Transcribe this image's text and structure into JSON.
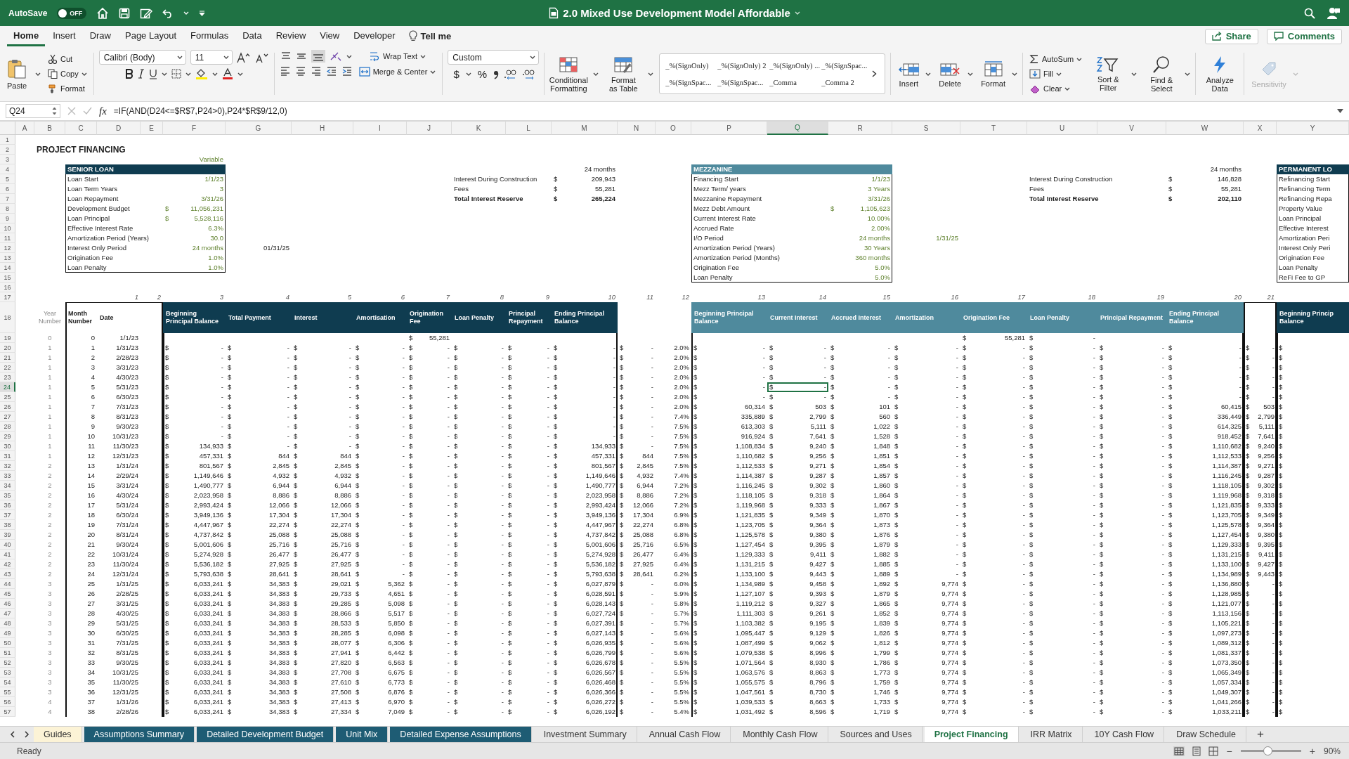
{
  "title_bar": {
    "autosave_label": "AutoSave",
    "autosave_on": false,
    "autosave_state": "OFF",
    "title": "2.0 Mixed Use Development Model Affordable"
  },
  "menu_tabs": [
    {
      "label": "Home",
      "selected": true
    },
    {
      "label": "Insert",
      "selected": false
    },
    {
      "label": "Draw",
      "selected": false
    },
    {
      "label": "Page Layout",
      "selected": false
    },
    {
      "label": "Formulas",
      "selected": false
    },
    {
      "label": "Data",
      "selected": false
    },
    {
      "label": "Review",
      "selected": false
    },
    {
      "label": "View",
      "selected": false
    },
    {
      "label": "Developer",
      "selected": false
    }
  ],
  "tell_me": "Tell me",
  "share": "Share",
  "comments": "Comments",
  "ribbon": {
    "paste": "Paste",
    "cut": "Cut",
    "copy": "Copy",
    "format_painter": "Format",
    "font_name": "Calibri (Body)",
    "font_size": "11",
    "wrap_text": "Wrap Text",
    "merge": "Merge & Center",
    "number_format": "Custom",
    "currency": "$",
    "percent": "%",
    "conditional": "Conditional Formatting",
    "format_table": "Format as Table",
    "styles": [
      "_%(SignOnly)",
      "_%(SignOnly) 2",
      "_%(SignOnly) ...",
      "_%(SignSpac...",
      "_%(SignSpac...",
      "_%(SignSpac...",
      "_Comma",
      "_Comma 2"
    ],
    "cells": [
      "Insert",
      "Delete",
      "Format"
    ],
    "autosum": "AutoSum",
    "fill": "Fill",
    "clear": "Clear",
    "sort": "Sort & Filter",
    "find": "Find & Select",
    "analyze": "Analyze Data",
    "sensitivity": {
      "label": "Sensitivity",
      "disabled": true
    }
  },
  "formula_bar": {
    "name_box": "Q24",
    "fx": "fx",
    "formula": "=IF(AND(D24<=$R$7,P24>0),P24*$R$9/12,0)"
  },
  "columns": [
    {
      "letter": "A",
      "selected": false
    },
    {
      "letter": "B",
      "kind": "muted",
      "selected": false
    },
    {
      "letter": "C",
      "kind": "number",
      "selected": false
    },
    {
      "letter": "D",
      "kind": "number",
      "selected": false
    },
    {
      "letter": "E",
      "selected": false
    },
    {
      "letter": "F",
      "kind": "accounting",
      "selected": false
    },
    {
      "letter": "G",
      "kind": "accounting",
      "selected": false
    },
    {
      "letter": "H",
      "kind": "accounting",
      "selected": false
    },
    {
      "letter": "I",
      "kind": "accounting",
      "selected": false
    },
    {
      "letter": "J",
      "kind": "accounting",
      "selected": false
    },
    {
      "letter": "K",
      "kind": "accounting",
      "selected": false
    },
    {
      "letter": "L",
      "kind": "accounting",
      "selected": false
    },
    {
      "letter": "M",
      "kind": "accounting",
      "selected": false
    },
    {
      "letter": "N",
      "kind": "accounting",
      "selected": false
    },
    {
      "letter": "O",
      "kind": "number",
      "selected": false
    },
    {
      "letter": "P",
      "kind": "accounting",
      "selected": false
    },
    {
      "letter": "Q",
      "kind": "accounting",
      "selected": true
    },
    {
      "letter": "R",
      "kind": "accounting",
      "selected": false
    },
    {
      "letter": "S",
      "kind": "accounting",
      "selected": false
    },
    {
      "letter": "T",
      "kind": "accounting",
      "selected": false
    },
    {
      "letter": "U",
      "kind": "accounting",
      "selected": false
    },
    {
      "letter": "V",
      "kind": "accounting",
      "selected": false
    },
    {
      "letter": "W",
      "kind": "accounting",
      "selected": false
    },
    {
      "letter": "X",
      "kind": "accounting",
      "selected": false
    },
    {
      "letter": "Y",
      "kind": "text",
      "selected": false
    }
  ],
  "row_headers": [
    {
      "label": "1",
      "selected": false
    },
    {
      "label": "2",
      "selected": false
    },
    {
      "label": "3",
      "selected": false
    },
    {
      "label": "4",
      "selected": false
    },
    {
      "label": "5",
      "selected": false
    },
    {
      "label": "6",
      "selected": false
    },
    {
      "label": "7",
      "selected": false
    },
    {
      "label": "8",
      "selected": false
    },
    {
      "label": "9",
      "selected": false
    },
    {
      "label": "10",
      "selected": false
    },
    {
      "label": "11",
      "selected": false
    },
    {
      "label": "12",
      "selected": false
    },
    {
      "label": "13",
      "selected": false
    },
    {
      "label": "14",
      "selected": false
    },
    {
      "label": "15",
      "selected": false
    },
    {
      "label": "16",
      "selected": false
    },
    {
      "label": "17",
      "selected": false
    },
    {
      "label": "18",
      "selected": false
    },
    {
      "label": "19",
      "selected": false
    },
    {
      "label": "20",
      "selected": false
    },
    {
      "label": "21",
      "selected": false
    },
    {
      "label": "22",
      "selected": false
    },
    {
      "label": "23",
      "selected": false
    },
    {
      "label": "24",
      "selected": true
    },
    {
      "label": "25",
      "selected": false
    },
    {
      "label": "26",
      "selected": false
    },
    {
      "label": "27",
      "selected": false
    },
    {
      "label": "28",
      "selected": false
    },
    {
      "label": "29",
      "selected": false
    },
    {
      "label": "30",
      "selected": false
    },
    {
      "label": "31",
      "selected": false
    },
    {
      "label": "32",
      "selected": false
    },
    {
      "label": "33",
      "selected": false
    },
    {
      "label": "34",
      "selected": false
    },
    {
      "label": "35",
      "selected": false
    },
    {
      "label": "36",
      "selected": false
    },
    {
      "label": "37",
      "selected": false
    },
    {
      "label": "38",
      "selected": false
    },
    {
      "label": "39",
      "selected": false
    },
    {
      "label": "40",
      "selected": false
    },
    {
      "label": "41",
      "selected": false
    },
    {
      "label": "42",
      "selected": false
    },
    {
      "label": "43",
      "selected": false
    },
    {
      "label": "44",
      "selected": false
    },
    {
      "label": "45",
      "selected": false
    },
    {
      "label": "46",
      "selected": false
    },
    {
      "label": "47",
      "selected": false
    },
    {
      "label": "48",
      "selected": false
    },
    {
      "label": "49",
      "selected": false
    },
    {
      "label": "50",
      "selected": false
    },
    {
      "label": "51",
      "selected": false
    },
    {
      "label": "52",
      "selected": false
    },
    {
      "label": "53",
      "selected": false
    },
    {
      "label": "54",
      "selected": false
    },
    {
      "label": "55",
      "selected": false
    },
    {
      "label": "56",
      "selected": false
    },
    {
      "label": "57",
      "selected": false
    }
  ],
  "sheet_title": "PROJECT FINANCING",
  "senior_loan": {
    "note": "Variable",
    "title": "SENIOR LOAN",
    "io_end": "01/31/25",
    "fields": [
      {
        "label": "Loan Start",
        "value": "1/1/23"
      },
      {
        "label": "Loan Term Years",
        "value": "3"
      },
      {
        "label": "Loan Repayment",
        "value": "3/31/26"
      },
      {
        "label": "Development Budget",
        "currency": "$",
        "value": "11,056,231"
      },
      {
        "label": "Loan Principal",
        "currency": "$",
        "value": "5,528,116"
      },
      {
        "label": "Effective Interest Rate",
        "value": "6.3%"
      },
      {
        "label": "Amortization Period (Years)",
        "value": "30.0"
      },
      {
        "label": "Interest Only Period",
        "value": "24 months"
      },
      {
        "label": "Origination Fee",
        "value": "1.0%"
      },
      {
        "label": "Loan Penalty",
        "value": "1.0%"
      }
    ]
  },
  "senior_reserve": {
    "term": "24 months",
    "items": [
      {
        "label": "Interest During Construction",
        "currency": "$",
        "value": "209,943",
        "bold": false
      },
      {
        "label": "Fees",
        "currency": "$",
        "value": "55,281",
        "bold": false
      },
      {
        "label": "Total Interest Reserve",
        "currency": "$",
        "value": "265,224",
        "bold": true
      }
    ]
  },
  "mezzanine": {
    "title": "MEZZANINE",
    "io_end": "1/31/25",
    "fields": [
      {
        "label": "Financing Start",
        "value": "1/1/23"
      },
      {
        "label": "Mezz Term/ years",
        "value": "3 Years"
      },
      {
        "label": "Mezzanine Repayment",
        "value": "3/31/26"
      },
      {
        "label": "Mezz Debt Amount",
        "currency": "$",
        "value": "1,105,623"
      },
      {
        "label": "Current Interest Rate",
        "value": "10.00%"
      },
      {
        "label": "Accrued Rate",
        "value": "2.00%"
      },
      {
        "label": "I/O Period",
        "value": "24 months"
      },
      {
        "label": "Amortization Period (Years)",
        "value": "30 Years"
      },
      {
        "label": "Amortization Period (Months)",
        "value": "360 months"
      },
      {
        "label": "Origination Fee",
        "value": "5.0%"
      },
      {
        "label": "Loan Penalty",
        "value": "5.0%"
      }
    ]
  },
  "mezz_reserve": {
    "term": "24 months",
    "items": [
      {
        "label": "Interest During Construction",
        "currency": "$",
        "value": "146,828",
        "bold": false
      },
      {
        "label": "Fees",
        "currency": "$",
        "value": "55,281",
        "bold": false
      },
      {
        "label": "Total Interest Reserve",
        "currency": "$",
        "value": "202,110",
        "bold": true
      }
    ]
  },
  "permanent_loan": {
    "title": "PERMANENT LO",
    "fields": [
      "Refinancing Start",
      "Refinancing Term",
      "Refinancing Repa",
      "Property Value",
      "Loan Principal",
      "Effective Interest",
      "Amortization Peri",
      "Interest Only Peri",
      "Origination Fee",
      "Loan Penalty",
      "ReFi Fee to GP"
    ]
  },
  "column_numbers": [
    "1",
    "2",
    "3",
    "4",
    "5",
    "6",
    "7",
    "8",
    "9",
    "10",
    "11",
    "12",
    "13",
    "14",
    "15",
    "16",
    "17",
    "18",
    "19",
    "20",
    "21"
  ],
  "table_headers": {
    "year": "Year Number",
    "month": "Month Number",
    "date": "Date",
    "senior": [
      "Beginning Principal Balance",
      "Total Payment",
      "Interest",
      "Amortisation",
      "Origination Fee",
      "Loan Penalty",
      "Principal Repayment",
      "Ending Principal Balance"
    ],
    "mezzanine": [
      "Beginning Principal Balance",
      "Current Interest",
      "Accrued Interest",
      "Amortization",
      "Origination Fee",
      "Loan Penalty",
      "Principal Repayment",
      "Ending Principal Balance"
    ],
    "permanent": "Beginning Princip Balance"
  },
  "rows": [
    [
      null,
      "0",
      "0",
      "1/1/23",
      null,
      null,
      null,
      null,
      null,
      "55,281",
      null,
      null,
      null,
      null,
      null,
      null,
      null,
      null,
      null,
      "55,281",
      "-",
      null,
      null,
      null,
      null
    ],
    [
      null,
      "1",
      "1",
      "1/31/23",
      null,
      "-",
      "-",
      "-",
      "-",
      "-",
      "-",
      "-",
      "-",
      "-",
      "2.0%",
      "-",
      "-",
      "-",
      "-",
      "-",
      "-",
      "-",
      "-",
      "-",
      "$"
    ],
    [
      null,
      "1",
      "2",
      "2/28/23",
      null,
      "-",
      "-",
      "-",
      "-",
      "-",
      "-",
      "-",
      "-",
      "-",
      "2.0%",
      "-",
      "-",
      "-",
      "-",
      "-",
      "-",
      "-",
      "-",
      "-",
      "$"
    ],
    [
      null,
      "1",
      "3",
      "3/31/23",
      null,
      "-",
      "-",
      "-",
      "-",
      "-",
      "-",
      "-",
      "-",
      "-",
      "2.0%",
      "-",
      "-",
      "-",
      "-",
      "-",
      "-",
      "-",
      "-",
      "-",
      "$"
    ],
    [
      null,
      "1",
      "4",
      "4/30/23",
      null,
      "-",
      "-",
      "-",
      "-",
      "-",
      "-",
      "-",
      "-",
      "-",
      "2.0%",
      "-",
      "-",
      "-",
      "-",
      "-",
      "-",
      "-",
      "-",
      "-",
      "$"
    ],
    [
      null,
      "1",
      "5",
      "5/31/23",
      null,
      "-",
      "-",
      "-",
      "-",
      "-",
      "-",
      "-",
      "-",
      "-",
      "2.0%",
      "-",
      "-",
      "-",
      "-",
      "-",
      "-",
      "-",
      "-",
      "-",
      "$"
    ],
    [
      null,
      "1",
      "6",
      "6/30/23",
      null,
      "-",
      "-",
      "-",
      "-",
      "-",
      "-",
      "-",
      "-",
      "-",
      "2.0%",
      "-",
      "-",
      "-",
      "-",
      "-",
      "-",
      "-",
      "-",
      "-",
      "$"
    ],
    [
      null,
      "1",
      "7",
      "7/31/23",
      null,
      "-",
      "-",
      "-",
      "-",
      "-",
      "-",
      "-",
      "-",
      "-",
      "2.0%",
      "60,314",
      "503",
      "101",
      "-",
      "-",
      "-",
      "-",
      "60,415",
      "503",
      "$"
    ],
    [
      null,
      "1",
      "8",
      "8/31/23",
      null,
      "-",
      "-",
      "-",
      "-",
      "-",
      "-",
      "-",
      "-",
      "-",
      "7.4%",
      "335,889",
      "2,799",
      "560",
      "-",
      "-",
      "-",
      "-",
      "336,449",
      "2,799",
      "$"
    ],
    [
      null,
      "1",
      "9",
      "9/30/23",
      null,
      "-",
      "-",
      "-",
      "-",
      "-",
      "-",
      "-",
      "-",
      "-",
      "7.5%",
      "613,303",
      "5,111",
      "1,022",
      "-",
      "-",
      "-",
      "-",
      "614,325",
      "5,111",
      "$"
    ],
    [
      null,
      "1",
      "10",
      "10/31/23",
      null,
      "-",
      "-",
      "-",
      "-",
      "-",
      "-",
      "-",
      "-",
      "-",
      "7.5%",
      "916,924",
      "7,641",
      "1,528",
      "-",
      "-",
      "-",
      "-",
      "918,452",
      "7,641",
      "$"
    ],
    [
      null,
      "1",
      "11",
      "11/30/23",
      null,
      "134,933",
      "-",
      "-",
      "-",
      "-",
      "-",
      "-",
      "134,933",
      "-",
      "7.5%",
      "1,108,834",
      "9,240",
      "1,848",
      "-",
      "-",
      "-",
      "-",
      "1,110,682",
      "9,240",
      "$"
    ],
    [
      null,
      "1",
      "12",
      "12/31/23",
      null,
      "457,331",
      "844",
      "844",
      "-",
      "-",
      "-",
      "-",
      "457,331",
      "844",
      "7.5%",
      "1,110,682",
      "9,256",
      "1,851",
      "-",
      "-",
      "-",
      "-",
      "1,112,533",
      "9,256",
      "$"
    ],
    [
      null,
      "2",
      "13",
      "1/31/24",
      null,
      "801,567",
      "2,845",
      "2,845",
      "-",
      "-",
      "-",
      "-",
      "801,567",
      "2,845",
      "7.5%",
      "1,112,533",
      "9,271",
      "1,854",
      "-",
      "-",
      "-",
      "-",
      "1,114,387",
      "9,271",
      "$"
    ],
    [
      null,
      "2",
      "14",
      "2/29/24",
      null,
      "1,149,646",
      "4,932",
      "4,932",
      "-",
      "-",
      "-",
      "-",
      "1,149,646",
      "4,932",
      "7.4%",
      "1,114,387",
      "9,287",
      "1,857",
      "-",
      "-",
      "-",
      "-",
      "1,116,245",
      "9,287",
      "$"
    ],
    [
      null,
      "2",
      "15",
      "3/31/24",
      null,
      "1,490,777",
      "6,944",
      "6,944",
      "-",
      "-",
      "-",
      "-",
      "1,490,777",
      "6,944",
      "7.2%",
      "1,116,245",
      "9,302",
      "1,860",
      "-",
      "-",
      "-",
      "-",
      "1,118,105",
      "9,302",
      "$"
    ],
    [
      null,
      "2",
      "16",
      "4/30/24",
      null,
      "2,023,958",
      "8,886",
      "8,886",
      "-",
      "-",
      "-",
      "-",
      "2,023,958",
      "8,886",
      "7.2%",
      "1,118,105",
      "9,318",
      "1,864",
      "-",
      "-",
      "-",
      "-",
      "1,119,968",
      "9,318",
      "$"
    ],
    [
      null,
      "2",
      "17",
      "5/31/24",
      null,
      "2,993,424",
      "12,066",
      "12,066",
      "-",
      "-",
      "-",
      "-",
      "2,993,424",
      "12,066",
      "7.2%",
      "1,119,968",
      "9,333",
      "1,867",
      "-",
      "-",
      "-",
      "-",
      "1,121,835",
      "9,333",
      "$"
    ],
    [
      null,
      "2",
      "18",
      "6/30/24",
      null,
      "3,949,136",
      "17,304",
      "17,304",
      "-",
      "-",
      "-",
      "-",
      "3,949,136",
      "17,304",
      "6.9%",
      "1,121,835",
      "9,349",
      "1,870",
      "-",
      "-",
      "-",
      "-",
      "1,123,705",
      "9,349",
      "$"
    ],
    [
      null,
      "2",
      "19",
      "7/31/24",
      null,
      "4,447,967",
      "22,274",
      "22,274",
      "-",
      "-",
      "-",
      "-",
      "4,447,967",
      "22,274",
      "6.8%",
      "1,123,705",
      "9,364",
      "1,873",
      "-",
      "-",
      "-",
      "-",
      "1,125,578",
      "9,364",
      "$"
    ],
    [
      null,
      "2",
      "20",
      "8/31/24",
      null,
      "4,737,842",
      "25,088",
      "25,088",
      "-",
      "-",
      "-",
      "-",
      "4,737,842",
      "25,088",
      "6.8%",
      "1,125,578",
      "9,380",
      "1,876",
      "-",
      "-",
      "-",
      "-",
      "1,127,454",
      "9,380",
      "$"
    ],
    [
      null,
      "2",
      "21",
      "9/30/24",
      null,
      "5,001,606",
      "25,716",
      "25,716",
      "-",
      "-",
      "-",
      "-",
      "5,001,606",
      "25,716",
      "6.5%",
      "1,127,454",
      "9,395",
      "1,879",
      "-",
      "-",
      "-",
      "-",
      "1,129,333",
      "9,395",
      "$"
    ],
    [
      null,
      "2",
      "22",
      "10/31/24",
      null,
      "5,274,928",
      "26,477",
      "26,477",
      "-",
      "-",
      "-",
      "-",
      "5,274,928",
      "26,477",
      "6.4%",
      "1,129,333",
      "9,411",
      "1,882",
      "-",
      "-",
      "-",
      "-",
      "1,131,215",
      "9,411",
      "$"
    ],
    [
      null,
      "2",
      "23",
      "11/30/24",
      null,
      "5,536,182",
      "27,925",
      "27,925",
      "-",
      "-",
      "-",
      "-",
      "5,536,182",
      "27,925",
      "6.4%",
      "1,131,215",
      "9,427",
      "1,885",
      "-",
      "-",
      "-",
      "-",
      "1,133,100",
      "9,427",
      "$"
    ],
    [
      null,
      "2",
      "24",
      "12/31/24",
      null,
      "5,793,638",
      "28,641",
      "28,641",
      "-",
      "-",
      "-",
      "-",
      "5,793,638",
      "28,641",
      "6.2%",
      "1,133,100",
      "9,443",
      "1,889",
      "-",
      "-",
      "-",
      "-",
      "1,134,989",
      "9,443",
      "$"
    ],
    [
      null,
      "3",
      "25",
      "1/31/25",
      null,
      "6,033,241",
      "34,383",
      "29,021",
      "5,362",
      "-",
      "-",
      "-",
      "6,027,879",
      "-",
      "6.0%",
      "1,134,989",
      "9,458",
      "1,892",
      "9,774",
      "-",
      "-",
      "-",
      "1,136,880",
      "-",
      "$"
    ],
    [
      null,
      "3",
      "26",
      "2/28/25",
      null,
      "6,033,241",
      "34,383",
      "29,733",
      "4,651",
      "-",
      "-",
      "-",
      "6,028,591",
      "-",
      "5.9%",
      "1,127,107",
      "9,393",
      "1,879",
      "9,774",
      "-",
      "-",
      "-",
      "1,128,985",
      "-",
      "$"
    ],
    [
      null,
      "3",
      "27",
      "3/31/25",
      null,
      "6,033,241",
      "34,383",
      "29,285",
      "5,098",
      "-",
      "-",
      "-",
      "6,028,143",
      "-",
      "5.8%",
      "1,119,212",
      "9,327",
      "1,865",
      "9,774",
      "-",
      "-",
      "-",
      "1,121,077",
      "-",
      "$"
    ],
    [
      null,
      "3",
      "28",
      "4/30/25",
      null,
      "6,033,241",
      "34,383",
      "28,866",
      "5,517",
      "-",
      "-",
      "-",
      "6,027,724",
      "-",
      "5.7%",
      "1,111,303",
      "9,261",
      "1,852",
      "9,774",
      "-",
      "-",
      "-",
      "1,113,156",
      "-",
      "$"
    ],
    [
      null,
      "3",
      "29",
      "5/31/25",
      null,
      "6,033,241",
      "34,383",
      "28,533",
      "5,850",
      "-",
      "-",
      "-",
      "6,027,391",
      "-",
      "5.7%",
      "1,103,382",
      "9,195",
      "1,839",
      "9,774",
      "-",
      "-",
      "-",
      "1,105,221",
      "-",
      "$"
    ],
    [
      null,
      "3",
      "30",
      "6/30/25",
      null,
      "6,033,241",
      "34,383",
      "28,285",
      "6,098",
      "-",
      "-",
      "-",
      "6,027,143",
      "-",
      "5.6%",
      "1,095,447",
      "9,129",
      "1,826",
      "9,774",
      "-",
      "-",
      "-",
      "1,097,273",
      "-",
      "$"
    ],
    [
      null,
      "3",
      "31",
      "7/31/25",
      null,
      "6,033,241",
      "34,383",
      "28,077",
      "6,306",
      "-",
      "-",
      "-",
      "6,026,935",
      "-",
      "5.6%",
      "1,087,499",
      "9,062",
      "1,812",
      "9,774",
      "-",
      "-",
      "-",
      "1,089,312",
      "-",
      "$"
    ],
    [
      null,
      "3",
      "32",
      "8/31/25",
      null,
      "6,033,241",
      "34,383",
      "27,941",
      "6,442",
      "-",
      "-",
      "-",
      "6,026,799",
      "-",
      "5.6%",
      "1,079,538",
      "8,996",
      "1,799",
      "9,774",
      "-",
      "-",
      "-",
      "1,081,337",
      "-",
      "$"
    ],
    [
      null,
      "3",
      "33",
      "9/30/25",
      null,
      "6,033,241",
      "34,383",
      "27,820",
      "6,563",
      "-",
      "-",
      "-",
      "6,026,678",
      "-",
      "5.5%",
      "1,071,564",
      "8,930",
      "1,786",
      "9,774",
      "-",
      "-",
      "-",
      "1,073,350",
      "-",
      "$"
    ],
    [
      null,
      "3",
      "34",
      "10/31/25",
      null,
      "6,033,241",
      "34,383",
      "27,708",
      "6,675",
      "-",
      "-",
      "-",
      "6,026,567",
      "-",
      "5.5%",
      "1,063,576",
      "8,863",
      "1,773",
      "9,774",
      "-",
      "-",
      "-",
      "1,065,349",
      "-",
      "$"
    ],
    [
      null,
      "3",
      "35",
      "11/30/25",
      null,
      "6,033,241",
      "34,383",
      "27,610",
      "6,773",
      "-",
      "-",
      "-",
      "6,026,468",
      "-",
      "5.5%",
      "1,055,575",
      "8,796",
      "1,759",
      "9,774",
      "-",
      "-",
      "-",
      "1,057,334",
      "-",
      "$"
    ],
    [
      null,
      "3",
      "36",
      "12/31/25",
      null,
      "6,033,241",
      "34,383",
      "27,508",
      "6,876",
      "-",
      "-",
      "-",
      "6,026,366",
      "-",
      "5.5%",
      "1,047,561",
      "8,730",
      "1,746",
      "9,774",
      "-",
      "-",
      "-",
      "1,049,307",
      "-",
      "$"
    ],
    [
      null,
      "4",
      "37",
      "1/31/26",
      null,
      "6,033,241",
      "34,383",
      "27,413",
      "6,970",
      "-",
      "-",
      "-",
      "6,026,272",
      "-",
      "5.5%",
      "1,039,533",
      "8,663",
      "1,733",
      "9,774",
      "-",
      "-",
      "-",
      "1,041,266",
      "-",
      "$"
    ],
    [
      null,
      "4",
      "38",
      "2/28/26",
      null,
      "6,033,241",
      "34,383",
      "27,334",
      "7,049",
      "-",
      "-",
      "-",
      "6,026,192",
      "-",
      "5.4%",
      "1,031,492",
      "8,596",
      "1,719",
      "9,774",
      "-",
      "-",
      "-",
      "1,033,211",
      "-",
      "$"
    ]
  ],
  "sheet_tabs": [
    {
      "label": "Guides",
      "selected": false,
      "color": "#fcf3d6"
    },
    {
      "label": "Assumptions Summary",
      "selected": false,
      "color": "#1e5c74"
    },
    {
      "label": "Detailed Development Budget",
      "selected": false,
      "color": "#1e5c74"
    },
    {
      "label": "Unit Mix",
      "selected": false,
      "color": "#1e5c74"
    },
    {
      "label": "Detailed Expense Assumptions",
      "selected": false,
      "color": "#1e5c74"
    },
    {
      "label": "Investment Summary",
      "selected": false
    },
    {
      "label": "Annual Cash Flow",
      "selected": false
    },
    {
      "label": "Monthly Cash Flow",
      "selected": false
    },
    {
      "label": "Sources and Uses",
      "selected": false
    },
    {
      "label": "Project Financing",
      "selected": true
    },
    {
      "label": "IRR Matrix",
      "selected": false
    },
    {
      "label": "10Y Cash Flow",
      "selected": false
    },
    {
      "label": "Draw Schedule",
      "selected": false
    }
  ],
  "add_sheet": "+",
  "status_bar": {
    "status": "Ready",
    "zoom": {
      "level": 0.45
    },
    "zoom_out": "−",
    "zoom_in": "+",
    "zoom_label": "90%"
  }
}
